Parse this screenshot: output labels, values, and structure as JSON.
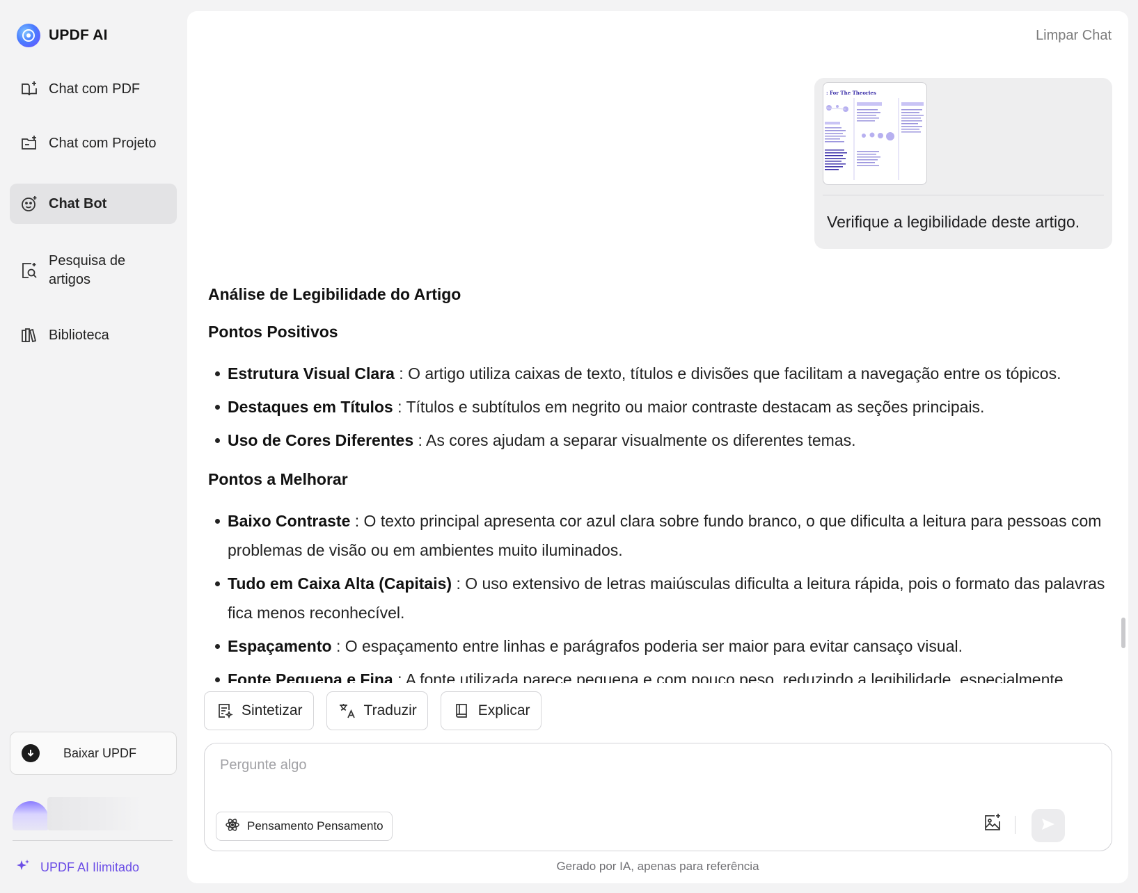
{
  "app": {
    "name": "UPDF AI"
  },
  "sidebar": {
    "items": [
      {
        "label": "Chat com PDF",
        "icon": "book-sparkle-icon"
      },
      {
        "label": "Chat com Projeto",
        "icon": "folder-sparkle-icon"
      },
      {
        "label": "Chat Bot",
        "icon": "bot-face-icon",
        "active": true
      },
      {
        "label": "Pesquisa de artigos",
        "icon": "document-search-icon"
      },
      {
        "label": "Biblioteca",
        "icon": "library-icon"
      }
    ],
    "download_label": "Baixar UPDF",
    "unlimited_label": "UPDF AI Ilimitado"
  },
  "header": {
    "clear_chat": "Limpar Chat"
  },
  "user_message": {
    "text": "Verifique a legibilidade deste artigo.",
    "attachment_title": ": For The Theories"
  },
  "answer": {
    "title": "Análise de Legibilidade do Artigo",
    "sections": [
      {
        "heading": "Pontos Positivos",
        "items": [
          {
            "term": "Estrutura Visual Clara",
            "text": " : O artigo utiliza caixas de texto, títulos e divisões que facilitam a navegação entre os tópicos."
          },
          {
            "term": "Destaques em Títulos",
            "text": " : Títulos e subtítulos em negrito ou maior contraste destacam as seções principais."
          },
          {
            "term": "Uso de Cores Diferentes",
            "text": " : As cores ajudam a separar visualmente os diferentes temas."
          }
        ]
      },
      {
        "heading": "Pontos a Melhorar",
        "items": [
          {
            "term": "Baixo Contraste",
            "text": " : O texto principal apresenta cor azul clara sobre fundo branco, o que dificulta a leitura para pessoas com problemas de visão ou em ambientes muito iluminados."
          },
          {
            "term": "Tudo em Caixa Alta (Capitais)",
            "text": " : O uso extensivo de letras maiúsculas dificulta a leitura rápida, pois o formato das palavras fica menos reconhecível."
          },
          {
            "term": "Espaçamento",
            "text": " : O espaçamento entre linhas e parágrafos poderia ser maior para evitar cansaço visual."
          },
          {
            "term": "Fonte Pequena e Fina",
            "text": " : A fonte utilizada parece pequena e com pouco peso, reduzindo a legibilidade, especialmente"
          }
        ]
      }
    ]
  },
  "actions": [
    {
      "label": "Sintetizar",
      "icon": "summarize-icon"
    },
    {
      "label": "Traduzir",
      "icon": "translate-icon"
    },
    {
      "label": "Explicar",
      "icon": "book-icon"
    }
  ],
  "composer": {
    "placeholder": "Pergunte algo",
    "value": "",
    "thinking_label": "Pensamento Pensamento"
  },
  "footer": {
    "note": "Gerado por IA, apenas para referência"
  },
  "colors": {
    "accent": "#6b4de6",
    "active_nav": "#e3e3e5",
    "panel": "#ffffff",
    "background": "#f3f3f4"
  }
}
